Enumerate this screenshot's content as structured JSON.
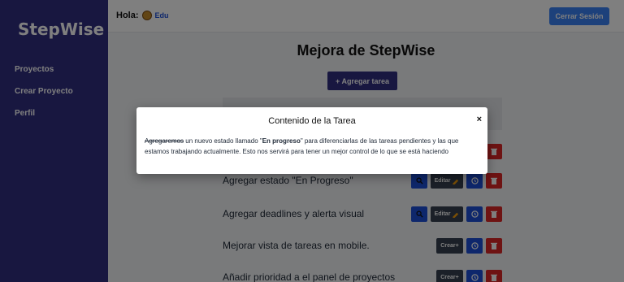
{
  "sidebar": {
    "brand": "StepWise",
    "items": [
      {
        "label": "Proyectos"
      },
      {
        "label": "Crear Proyecto"
      },
      {
        "label": "Perfil"
      }
    ]
  },
  "header": {
    "greeting": "Hola:",
    "user": "Edu",
    "logout_label": "Cerrar Sesión"
  },
  "main": {
    "title": "Mejora de StepWise",
    "add_task_label": "+ Agregar tarea",
    "tasks": [
      {
        "title": "Agregar estado \"En Progreso\"",
        "edit_label": "Editar"
      },
      {
        "title": "Agregar deadlines y alerta visual",
        "edit_label": "Editar"
      },
      {
        "title": "Mejorar vista de tareas en mobile.",
        "create_label": "Crear+"
      },
      {
        "title": "Añadir prioridad a el panel de proyectos",
        "create_label": "Crear+"
      }
    ]
  },
  "modal": {
    "title": "Contenido de la Tarea",
    "close_symbol": "×",
    "body": {
      "strike": "Agregaremos",
      "part1": " un nuevo estado llamado \"",
      "bold": "En progreso",
      "part2": "\" para diferenciarlas de las tareas pendientes y las que estamos trabajando actualmente. Esto nos servirá para tener un mejor control de lo que se está haciendo"
    }
  },
  "colors": {
    "sidebar": "#312e81",
    "primary": "#1d4ed8",
    "danger": "#dc2626",
    "dark": "#374151",
    "logout": "#3b82f6"
  },
  "icons": [
    "search-icon",
    "pencil-icon",
    "clock-icon",
    "trash-icon",
    "user-avatar-icon",
    "close-icon"
  ]
}
